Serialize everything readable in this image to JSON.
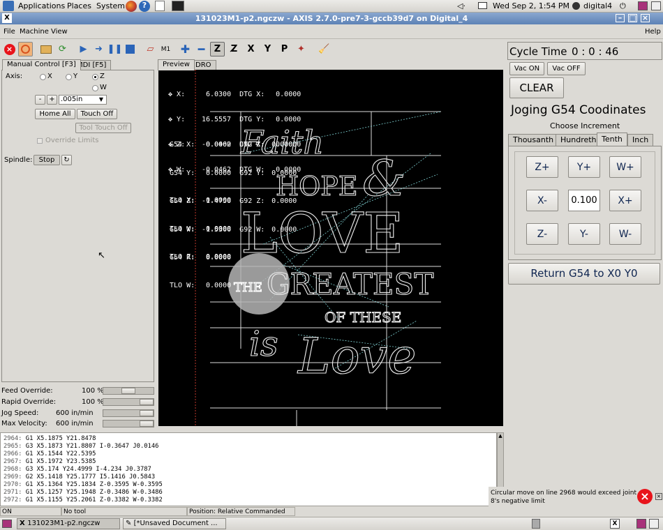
{
  "top_panel": {
    "applications": "Applications",
    "places": "Places",
    "system": "System",
    "datetime": "Wed Sep  2,  1:54 PM",
    "user": "digital4"
  },
  "window": {
    "title": "131023M1-p2.ngczw - AXIS 2.7.0-pre7-3-gccb39d7 on Digital_4"
  },
  "menu": {
    "file": "File",
    "machine": "Machine",
    "view": "View",
    "help": "Help"
  },
  "manual": {
    "tab1": "Manual Control [F3]",
    "tab2": "MDI [F5]",
    "axis_label": "Axis:",
    "axes": [
      "X",
      "Y",
      "Z",
      "W"
    ],
    "selected_axis": "Z",
    "minus": "-",
    "plus": "+",
    "increment": ".005in",
    "home_all": "Home All",
    "touch_off": "Touch Off",
    "tool_touch_off": "Tool Touch Off",
    "override_limits": "Override Limits",
    "spindle_label": "Spindle:",
    "stop": "Stop"
  },
  "overrides": [
    {
      "label": "Feed Override:",
      "value": "100 %",
      "level": 0.5
    },
    {
      "label": "Rapid Override:",
      "value": "100 %",
      "level": 1.0
    },
    {
      "label": "Jog Speed:",
      "value": "600 in/min",
      "level": 1.0
    },
    {
      "label": "Max Velocity:",
      "value": "600 in/min",
      "level": 1.0
    }
  ],
  "preview_tabs": {
    "preview": "Preview",
    "dro": "DRO"
  },
  "dro": [
    {
      "axis": "X:",
      "val": "6.0300",
      "dtg": "DTG X:",
      "dv": "0.0000"
    },
    {
      "axis": "Y:",
      "val": "16.5557",
      "dtg": "DTG Y:",
      "dv": "0.0000"
    },
    {
      "axis": "Z:",
      "val": "-0.0462",
      "dtg": "DTG Z:",
      "dv": "0.0000"
    },
    {
      "axis": "W:",
      "val": "-0.0462",
      "dtg": "DTG W:",
      "dv": "0.0000"
    }
  ],
  "g54": [
    {
      "l": "G54 X:",
      "v": "0.0000",
      "g": "G92 X:",
      "gv": "0.0000"
    },
    {
      "l": "G54 Y:",
      "v": "0.0000",
      "g": "G92 Y:",
      "gv": "0.0000"
    },
    {
      "l": "G54 Z:",
      "v": "-1.4750",
      "g": "G92 Z:",
      "gv": "0.0000"
    },
    {
      "l": "G54 W:",
      "v": "-1.5300",
      "g": "G92 W:",
      "gv": "0.0000"
    },
    {
      "l": "G54 R:",
      "v": "0.0000",
      "g": "",
      "gv": ""
    }
  ],
  "tlo": [
    {
      "l": "TLO X:",
      "v": "0.0000"
    },
    {
      "l": "TLO Y:",
      "v": "0.0000"
    },
    {
      "l": "TLO Z:",
      "v": "0.0000"
    },
    {
      "l": "TLO W:",
      "v": "0.0000"
    }
  ],
  "artwork": {
    "faith": "Faith",
    "hope": "HOPE",
    "amp": "&",
    "love": "LOVE",
    "the": "THE",
    "greatest": "GREATEST",
    "of_these": "OF THESE",
    "is": "is",
    "love2": "Love"
  },
  "gcode": [
    {
      "n": "2964:",
      "c": "G1 X5.1875 Y21.8478"
    },
    {
      "n": "2965:",
      "c": "G3 X5.1873 Y21.8807 I-0.3647 J0.0146"
    },
    {
      "n": "2966:",
      "c": "G1 X5.1544 Y22.5395"
    },
    {
      "n": "2967:",
      "c": "G1 X5.1972 Y23.5385"
    },
    {
      "n": "2968:",
      "c": "G3 X5.174 Y24.4999 I-4.234 J0.3787"
    },
    {
      "n": "2969:",
      "c": "G2 X5.1418 Y25.1777 I5.1416 J0.5843"
    },
    {
      "n": "2970:",
      "c": "G1 X5.1364 Y25.1834 Z-0.3595 W-0.3595"
    },
    {
      "n": "2971:",
      "c": "G1 X5.1257 Y25.1948 Z-0.3486 W-0.3486"
    },
    {
      "n": "2972:",
      "c": "G1 X5.1155 Y25.2061 Z-0.3382 W-0.3382"
    }
  ],
  "status": {
    "state": "ON",
    "tool": "No tool",
    "position": "Position: Relative Commanded"
  },
  "error": {
    "line1": "Circular move on line 2968 would exceed joint",
    "line2": "8's negative limit"
  },
  "right": {
    "cycle_label": "Cycle Time",
    "cycle_value": "0 : 0 : 46",
    "vac_on": "Vac ON",
    "vac_off": "Vac OFF",
    "clear": "CLEAR",
    "jog_title": "Joging G54 Coodinates",
    "choose": "Choose Increment",
    "inc_tabs": [
      "Thousanth",
      "Hundreth",
      "Tenth",
      "Inch"
    ],
    "selected_inc": "Tenth",
    "zp": "Z+",
    "yp": "Y+",
    "wp": "W+",
    "xm": "X-",
    "inc_value": "0.100",
    "xp": "X+",
    "zm": "Z-",
    "ym": "Y-",
    "wm": "W-",
    "return": "Return G54 to X0 Y0"
  },
  "taskbar": {
    "item1": "131023M1-p2.ngczw",
    "item2": "[*Unsaved Document ..."
  },
  "colors": {
    "jog_text": "#0f2550",
    "error": "#e8141b",
    "titlebar": "#5d82b6"
  }
}
